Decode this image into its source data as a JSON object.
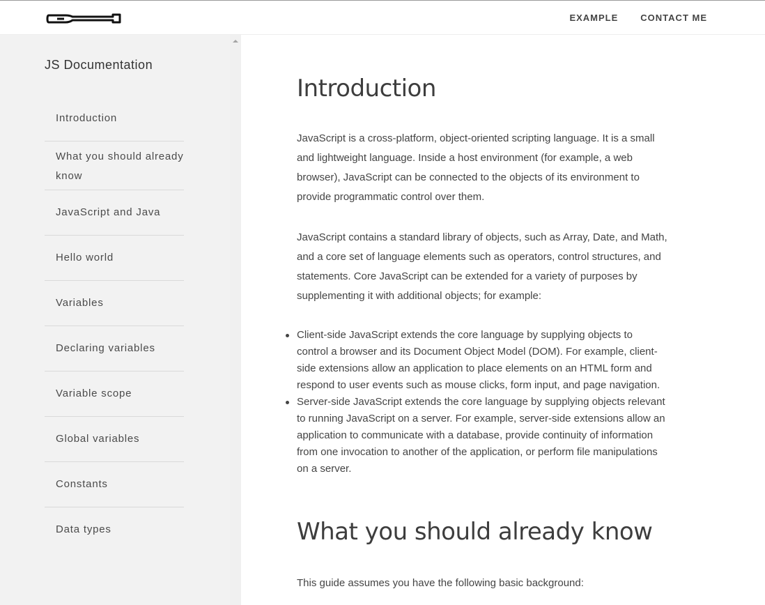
{
  "header": {
    "logo_icon": "paddle-logo-icon",
    "nav": [
      {
        "label": "EXAMPLE"
      },
      {
        "label": "CONTACT ME"
      }
    ]
  },
  "sidebar": {
    "title": "JS Documentation",
    "items": [
      {
        "label": "Introduction"
      },
      {
        "label": "What you should already know"
      },
      {
        "label": "JavaScript and Java"
      },
      {
        "label": "Hello world"
      },
      {
        "label": "Variables"
      },
      {
        "label": "Declaring variables"
      },
      {
        "label": "Variable scope"
      },
      {
        "label": "Global variables"
      },
      {
        "label": "Constants"
      },
      {
        "label": "Data types"
      }
    ]
  },
  "main": {
    "sections": [
      {
        "heading": "Introduction",
        "paragraphs": [
          "JavaScript is a cross-platform, object-oriented scripting language. It is a small and lightweight language. Inside a host environment (for example, a web browser), JavaScript can be connected to the objects of its environment to provide programmatic control over them.",
          "JavaScript contains a standard library of objects, such as Array, Date, and Math, and a core set of language elements such as operators, control structures, and statements. Core JavaScript can be extended for a variety of purposes by supplementing it with additional objects; for example:"
        ],
        "bullets": [
          "Client-side JavaScript extends the core language by supplying objects to control a browser and its Document Object Model (DOM). For example, client-side extensions allow an application to place elements on an HTML form and respond to user events such as mouse clicks, form input, and page navigation.",
          "Server-side JavaScript extends the core language by supplying objects relevant to running JavaScript on a server. For example, server-side extensions allow an application to communicate with a database, provide continuity of information from one invocation to another of the application, or perform file manipulations on a server."
        ]
      },
      {
        "heading": "What you should already know",
        "paragraphs": [
          "This guide assumes you have the following basic background:"
        ]
      }
    ]
  }
}
